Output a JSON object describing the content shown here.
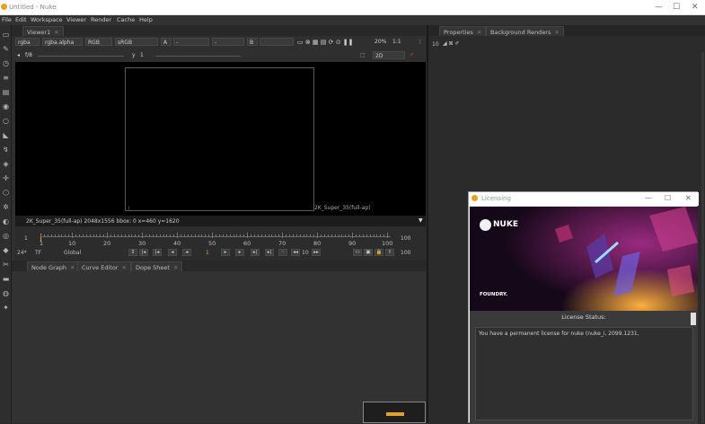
{
  "window": {
    "title": "Untitled - Nuke",
    "min": "—",
    "max": "☐",
    "close": "✕"
  },
  "menu": [
    "File",
    "Edit",
    "Workspace",
    "Viewer",
    "Render",
    "Cache",
    "Help"
  ],
  "viewer": {
    "tab_label": "Viewer1",
    "channels": "rgba",
    "alpha_channel": "rgba.alpha",
    "display_channels": "RGB",
    "colorspace": "sRGB",
    "input_a": "A",
    "input_a_value": "-",
    "input_b_value": "-",
    "input_b": "B",
    "zoom": "20%",
    "ratio": "1:1",
    "fstop": "f/8",
    "gain_value": "1",
    "gamma_label": "y",
    "gamma_value": "1",
    "view_mode": "2D",
    "format_label": "2K_Super_35(full-ap)",
    "info_text": "2K_Super_35(full-ap) 2048x1556  bbox: 0   x=460 y=1620"
  },
  "timeline": {
    "start_frame": "1",
    "end_frame": "100",
    "tick_labels": [
      "1",
      "10",
      "20",
      "30",
      "40",
      "50",
      "60",
      "70",
      "80",
      "90",
      "100"
    ],
    "current_frame": "1",
    "fps": "24*",
    "tf": "TF",
    "scope": "Global",
    "step_increment": "10",
    "out_frame": "100"
  },
  "node_tabs": [
    "Node Graph",
    "Curve Editor",
    "Dope Sheet"
  ],
  "props_tabs": [
    "Properties",
    "Background Renders"
  ],
  "props_count": "10",
  "licensing": {
    "title": "Licensing",
    "logo_text": "NUKE",
    "brand": "FOUNDRY.",
    "status_label": "License Status:",
    "message": "You have a permanent license for nuke (nuke_i, 2099.1231,"
  },
  "colors": {
    "accent": "#e8a020",
    "viewer_bg": "#000000",
    "panel_bg": "#2b2b2b"
  }
}
